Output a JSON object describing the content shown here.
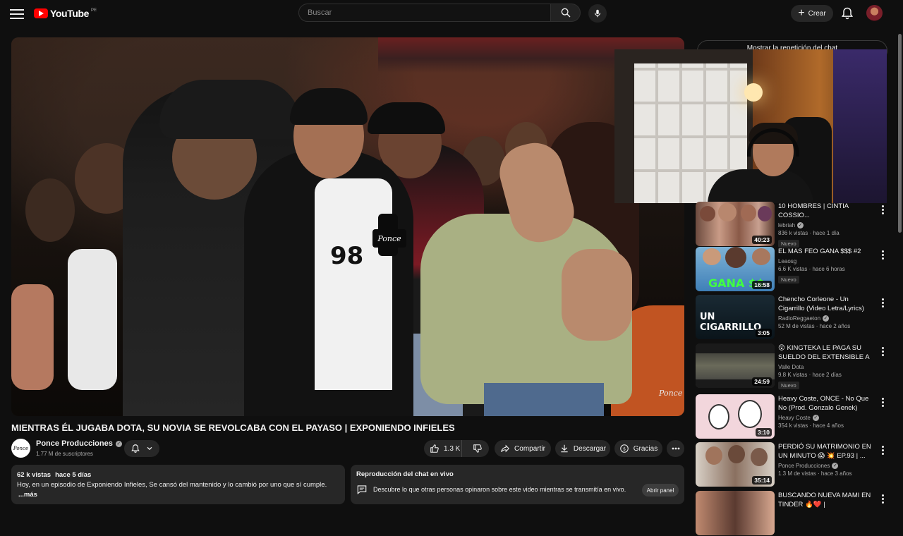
{
  "header": {
    "logo_text": "YouTube",
    "country": "PE",
    "search_placeholder": "Buscar",
    "create_label": "Crear"
  },
  "video": {
    "title": "MIENTRAS ÉL JUGABA DOTA, SU NOVIA SE REVOLCABA CON EL PAYASO | EXPONIENDO INFIELES",
    "mic_brand": "Ponce",
    "shirt_print": "98",
    "watermark": "Ponce",
    "chat_replay_button": "Mostrar la repetición del chat"
  },
  "channel": {
    "avatar_text": "Ponce",
    "name": "Ponce Producciones",
    "subscribers": "1.77 M de suscriptores"
  },
  "actions": {
    "likes": "1.3 K",
    "share": "Compartir",
    "download": "Descargar",
    "thanks": "Gracias"
  },
  "description": {
    "views": "62 k vistas",
    "date": "hace 5 días",
    "text": "Hoy, en un episodio  de Exponiendo Infieles, Se cansó del mantenido y lo cambió por uno que sí cumple.",
    "more": "...más"
  },
  "live_chat": {
    "heading": "Reproducción del chat en vivo",
    "text": "Descubre lo que otras personas opinaron sobre este video mientras se transmitía en vivo.",
    "button": "Abrir panel"
  },
  "recommendations": [
    {
      "title": "10 HOMBRES | CINTIA COSSIO...",
      "channel": "lebriah",
      "verified": true,
      "views": "836 k vistas · hace 1 día",
      "badge": "Nuevo",
      "duration": "40:23"
    },
    {
      "title": "EL MAS FEO GANA $$$ #2",
      "channel": "Leaosg",
      "verified": false,
      "views": "6.6 K vistas · hace 6 horas",
      "badge": "Nuevo",
      "duration": "16:58",
      "thumb_text": "GANA $$"
    },
    {
      "title": "Chencho Corleone - Un Cigarrillo (Video Letra/Lyrics)",
      "channel": "RadioReggaeton",
      "verified": true,
      "views": "52 M de vistas · hace 2 años",
      "badge": "",
      "duration": "3:05",
      "thumb_text": "UN CIGARRILLO"
    },
    {
      "title": "😲 KINGTEKA LE PAGA SU SUELDO DEL EXTENSIBLE A ...",
      "channel": "Valle Dota",
      "verified": false,
      "views": "9.8 K vistas · hace 2 días",
      "badge": "Nuevo",
      "duration": "24:59"
    },
    {
      "title": "Heavy Coste, ONCE - No Que No (Prod. Gonzalo Genek)",
      "channel": "Heavy Coste",
      "verified": true,
      "views": "354 k vistas · hace 4 años",
      "badge": "",
      "duration": "3:10"
    },
    {
      "title": "PERDIÓ SU MATRIMONIO EN UN MINUTO 😱 💥 EP.93 | ...",
      "channel": "Ponce Producciones",
      "verified": true,
      "views": "1.3 M de vistas · hace 3 años",
      "badge": "",
      "duration": "35:14"
    },
    {
      "title": "BUSCANDO NUEVA MAMI EN TINDER 🔥❤️ | SACHAUZUMAKI",
      "channel": "",
      "verified": false,
      "views": "",
      "badge": "",
      "duration": ""
    }
  ],
  "colors": {
    "background": "#0f0f0f",
    "surface": "#272727",
    "brand_red": "#ff0000",
    "text_secondary": "#aaaaaa"
  }
}
